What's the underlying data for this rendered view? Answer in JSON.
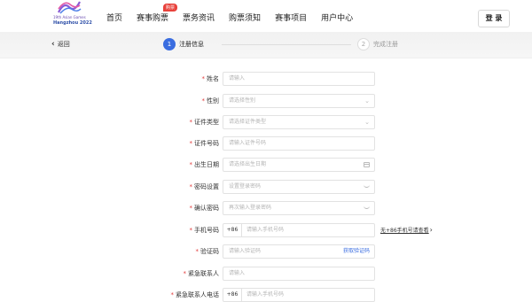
{
  "header": {
    "logo": {
      "line1": "19th Asian Games",
      "line2": "Hangzhou 2022"
    },
    "nav": [
      {
        "label": "首页"
      },
      {
        "label": "赛事购票",
        "badge": "购票"
      },
      {
        "label": "票务资讯"
      },
      {
        "label": "购票须知"
      },
      {
        "label": "赛事项目"
      },
      {
        "label": "用户中心"
      }
    ],
    "login": "登 录"
  },
  "steps": {
    "back": "返回",
    "step1": {
      "num": "1",
      "label": "注册信息"
    },
    "step2": {
      "num": "2",
      "label": "完成注册"
    }
  },
  "form": {
    "name": {
      "label": "姓名",
      "placeholder": "请输入"
    },
    "gender": {
      "label": "性别",
      "placeholder": "请选择性别"
    },
    "id_type": {
      "label": "证件类型",
      "placeholder": "请选择证件类型"
    },
    "id_number": {
      "label": "证件号码",
      "placeholder": "请输入证件号码"
    },
    "birthdate": {
      "label": "出生日期",
      "placeholder": "请选择出生日期"
    },
    "password": {
      "label": "密码设置",
      "placeholder": "设置登录密码"
    },
    "confirm_password": {
      "label": "确认密码",
      "placeholder": "再次输入登录密码"
    },
    "phone": {
      "label": "手机号码",
      "prefix": "+86",
      "placeholder": "请输入手机号码",
      "side_link": "无+86手机号请查看"
    },
    "code": {
      "label": "验证码",
      "placeholder": "请输入验证码",
      "get_code": "获取验证码"
    },
    "emergency_contact": {
      "label": "紧急联系人",
      "placeholder": "请输入"
    },
    "emergency_phone": {
      "label": "紧急联系人电话",
      "prefix": "+86",
      "placeholder": "请输入手机号码"
    }
  },
  "colors": {
    "primary": "#3a6de0",
    "required": "#e23c3c",
    "badge": "#e8423c"
  }
}
